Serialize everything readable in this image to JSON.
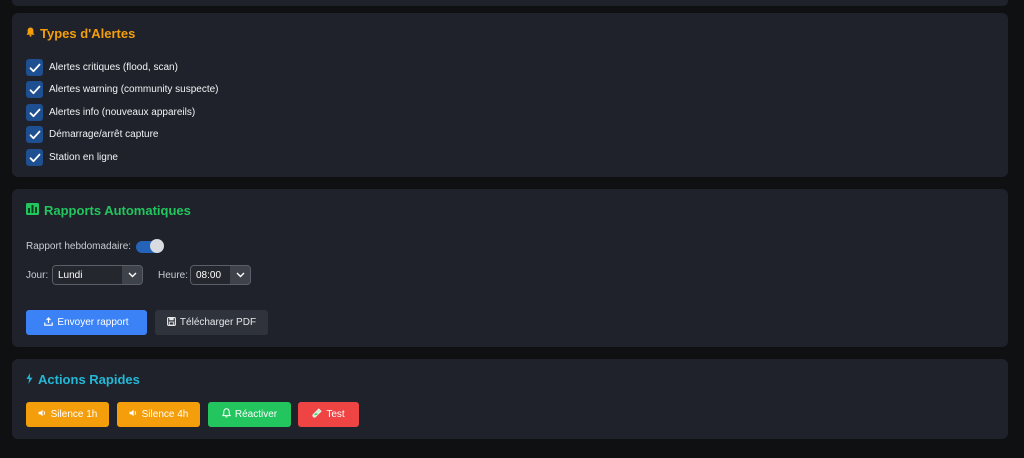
{
  "alerts_card": {
    "title": "Types d'Alertes",
    "title_icon": "bell-icon",
    "items": [
      {
        "label": "Alertes critiques (flood, scan)",
        "checked": true
      },
      {
        "label": "Alertes warning (community suspecte)",
        "checked": true
      },
      {
        "label": "Alertes info (nouveaux appareils)",
        "checked": true
      },
      {
        "label": "Démarrage/arrêt capture",
        "checked": true
      },
      {
        "label": "Station en ligne",
        "checked": true
      }
    ]
  },
  "reports_card": {
    "title": "Rapports Automatiques",
    "title_icon": "bar-chart-icon",
    "weekly_label": "Rapport hebdomadaire:",
    "weekly_enabled": true,
    "day_label": "Jour:",
    "day_value": "Lundi",
    "hour_label": "Heure:",
    "hour_value": "08:00",
    "send_button": "Envoyer rapport",
    "download_button": "Télécharger PDF"
  },
  "actions_card": {
    "title": "Actions Rapides",
    "title_icon": "lightning-icon",
    "buttons": {
      "silence_1h": "Silence 1h",
      "silence_4h": "Silence 4h",
      "reactivate": "Réactiver",
      "test": "Test"
    }
  },
  "colors": {
    "orange": "#f59e0b",
    "green": "#22c55e",
    "cyan": "#22b8d6",
    "blue": "#3b82f6",
    "red": "#ef4444"
  }
}
